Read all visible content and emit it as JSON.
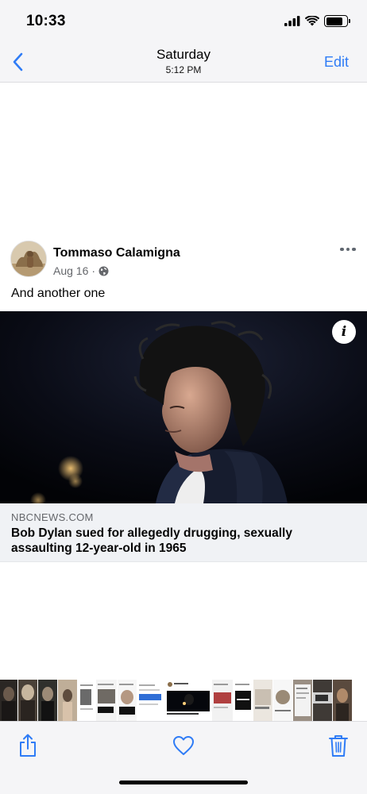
{
  "status_bar": {
    "time": "10:33",
    "battery_level": 0.8
  },
  "nav": {
    "title": "Saturday",
    "subtitle": "5:12 PM",
    "edit_label": "Edit",
    "back_icon": "chevron-left-icon"
  },
  "post": {
    "author": "Tommaso Calamigna",
    "date": "Aug 16",
    "separator": "·",
    "privacy_icon": "globe-icon",
    "text": "And another one",
    "link": {
      "domain": "NBCNEWS.COM",
      "title": "Bob Dylan sued for allegedly drugging, sexually assaulting 12-year-old in 1965",
      "info_glyph": "i"
    }
  },
  "thumbnails": [
    {
      "name": "thumb-1",
      "bg": "#2b2724"
    },
    {
      "name": "thumb-2",
      "bg": "#4a4138"
    },
    {
      "name": "thumb-3",
      "bg": "#30302c"
    },
    {
      "name": "thumb-4",
      "bg": "#a89884"
    },
    {
      "name": "thumb-5",
      "bg": "#ffffff"
    },
    {
      "name": "thumb-6",
      "bg": "#f4f4f4"
    },
    {
      "name": "thumb-7",
      "bg": "#f6f6f6"
    },
    {
      "name": "thumb-8",
      "bg": "#ffffff"
    },
    {
      "name": "thumb-9",
      "bg": "#f2f2f2"
    },
    {
      "name": "thumb-10",
      "bg": "#ffffff"
    },
    {
      "name": "thumb-11",
      "bg": "#ebe6df"
    },
    {
      "name": "thumb-12",
      "bg": "#f7f7f7"
    },
    {
      "name": "thumb-13",
      "bg": "#9a8f84"
    },
    {
      "name": "thumb-14",
      "bg": "#3f3a36"
    },
    {
      "name": "thumb-15",
      "bg": "#5a4a3e"
    }
  ],
  "toolbar": {
    "share_icon": "share-icon",
    "favorite_icon": "heart-icon",
    "delete_icon": "trash-icon"
  },
  "colors": {
    "accent": "#2f7cf6",
    "bar_bg": "#f5f5f7",
    "caption_bg": "#f0f2f5"
  }
}
